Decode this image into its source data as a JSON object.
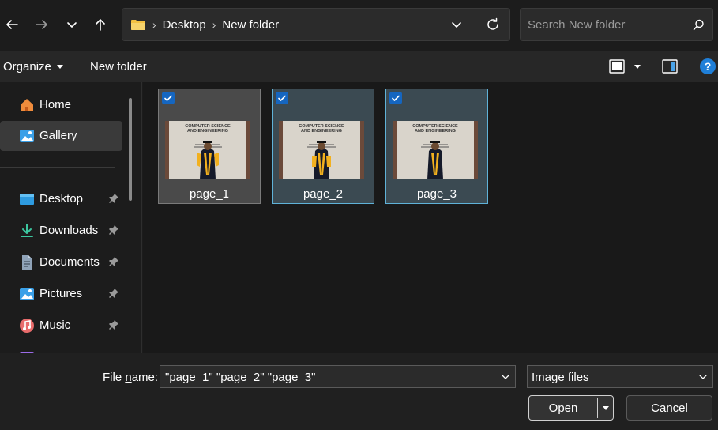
{
  "toolbar": {
    "breadcrumb": [
      "Desktop",
      "New folder"
    ],
    "search_placeholder": "Search New folder"
  },
  "commandbar": {
    "organize": "Organize",
    "new_folder": "New folder"
  },
  "sidebar": {
    "items": [
      {
        "label": "Home",
        "icon": "home-icon"
      },
      {
        "label": "Gallery",
        "icon": "gallery-icon",
        "selected": true
      },
      {
        "label": "Desktop",
        "icon": "desktop-icon",
        "pinned": true
      },
      {
        "label": "Downloads",
        "icon": "downloads-icon",
        "pinned": true
      },
      {
        "label": "Documents",
        "icon": "documents-icon",
        "pinned": true
      },
      {
        "label": "Pictures",
        "icon": "pictures-icon",
        "pinned": true
      },
      {
        "label": "Music",
        "icon": "music-icon",
        "pinned": true
      }
    ]
  },
  "files": [
    {
      "name": "page_1",
      "checked": true
    },
    {
      "name": "page_2",
      "checked": true
    },
    {
      "name": "page_3",
      "checked": true
    }
  ],
  "thumbnail_text": {
    "line1": "COMPUTER SCIENCE",
    "line2": "AND ENGINEERING"
  },
  "footer": {
    "file_name_label_prefix": "File ",
    "file_name_label_underline": "n",
    "file_name_label_suffix": "ame:",
    "file_name_value": "\"page_1\" \"page_2\" \"page_3\"",
    "file_type_value": "Image files",
    "open_label_underline": "O",
    "open_label_rest": "pen",
    "cancel_label": "Cancel"
  },
  "colors": {
    "accent": "#1566c0",
    "selection_border": "#5fb2d8",
    "folder_yellow": "#f4c142"
  }
}
